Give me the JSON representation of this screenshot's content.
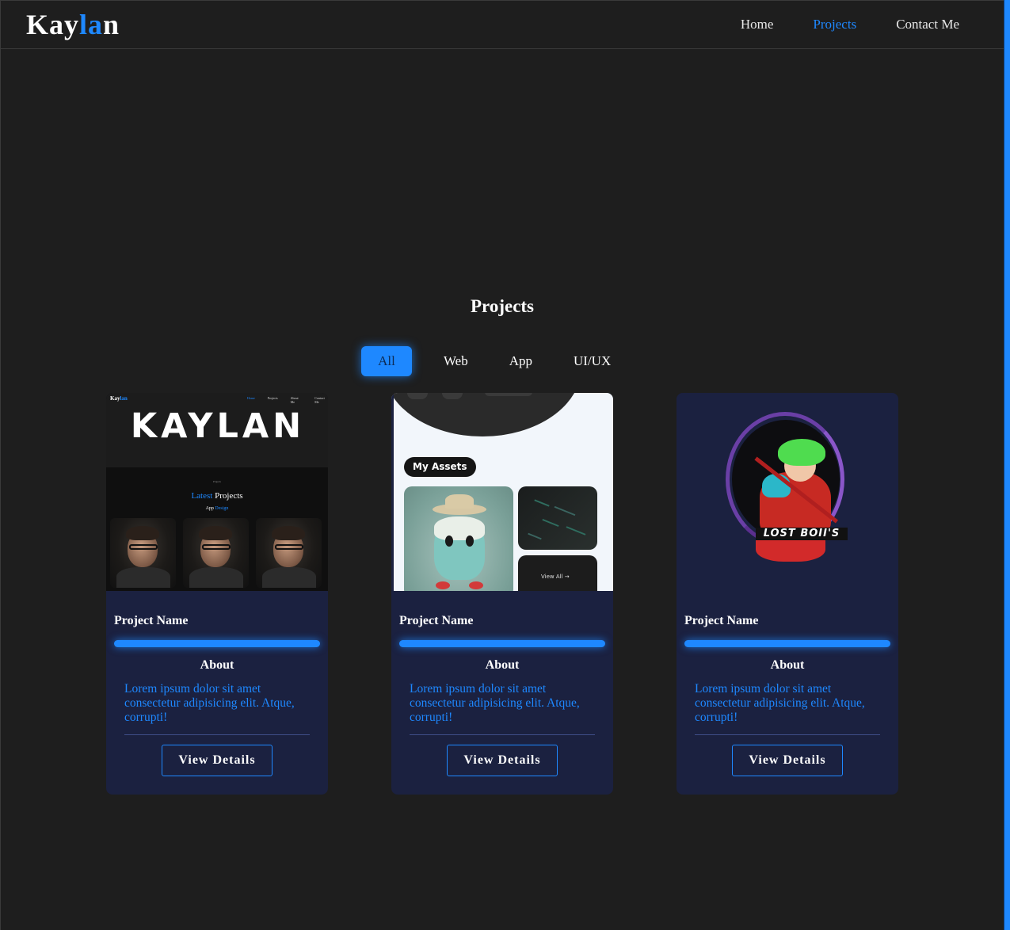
{
  "brand": {
    "logo_start": "Kay",
    "logo_accent": "la",
    "logo_end": "n"
  },
  "nav": {
    "items": [
      "Home",
      "Projects",
      "Contact Me"
    ],
    "active": "Projects"
  },
  "projects_section": {
    "title": "Projects",
    "filters": [
      "All",
      "Web",
      "App",
      "UI/UX"
    ],
    "active_filter": "All"
  },
  "cards": [
    {
      "name": "Project Name",
      "about_heading": "About",
      "description": "Lorem ipsum dolor sit amet consectetur adipisicing elit. Atque, corrupti!",
      "button_label": "View Details",
      "thumbnail": {
        "logo_start": "Kay",
        "logo_accent": "lan",
        "big_title": "KAYLAN",
        "latest_small": "Projects",
        "latest_accent": "Latest",
        "latest_rest": "Projects",
        "sub_plain": "App",
        "sub_accent": "Design"
      }
    },
    {
      "name": "Project Name",
      "about_heading": "About",
      "description": "Lorem ipsum dolor sit amet consectetur adipisicing elit. Atque, corrupti!",
      "button_label": "View Details",
      "thumbnail": {
        "assets_label": "My Assets",
        "view_all": "View All →"
      }
    },
    {
      "name": "Project Name",
      "about_heading": "About",
      "description": "Lorem ipsum dolor sit amet consectetur adipisicing elit. Atque, corrupti!",
      "button_label": "View Details",
      "thumbnail": {
        "artwork_text": "LOST BOII'S"
      }
    }
  ],
  "colors": {
    "accent": "#1e88ff",
    "background": "#1e1e1e",
    "card": "#1b2140"
  }
}
